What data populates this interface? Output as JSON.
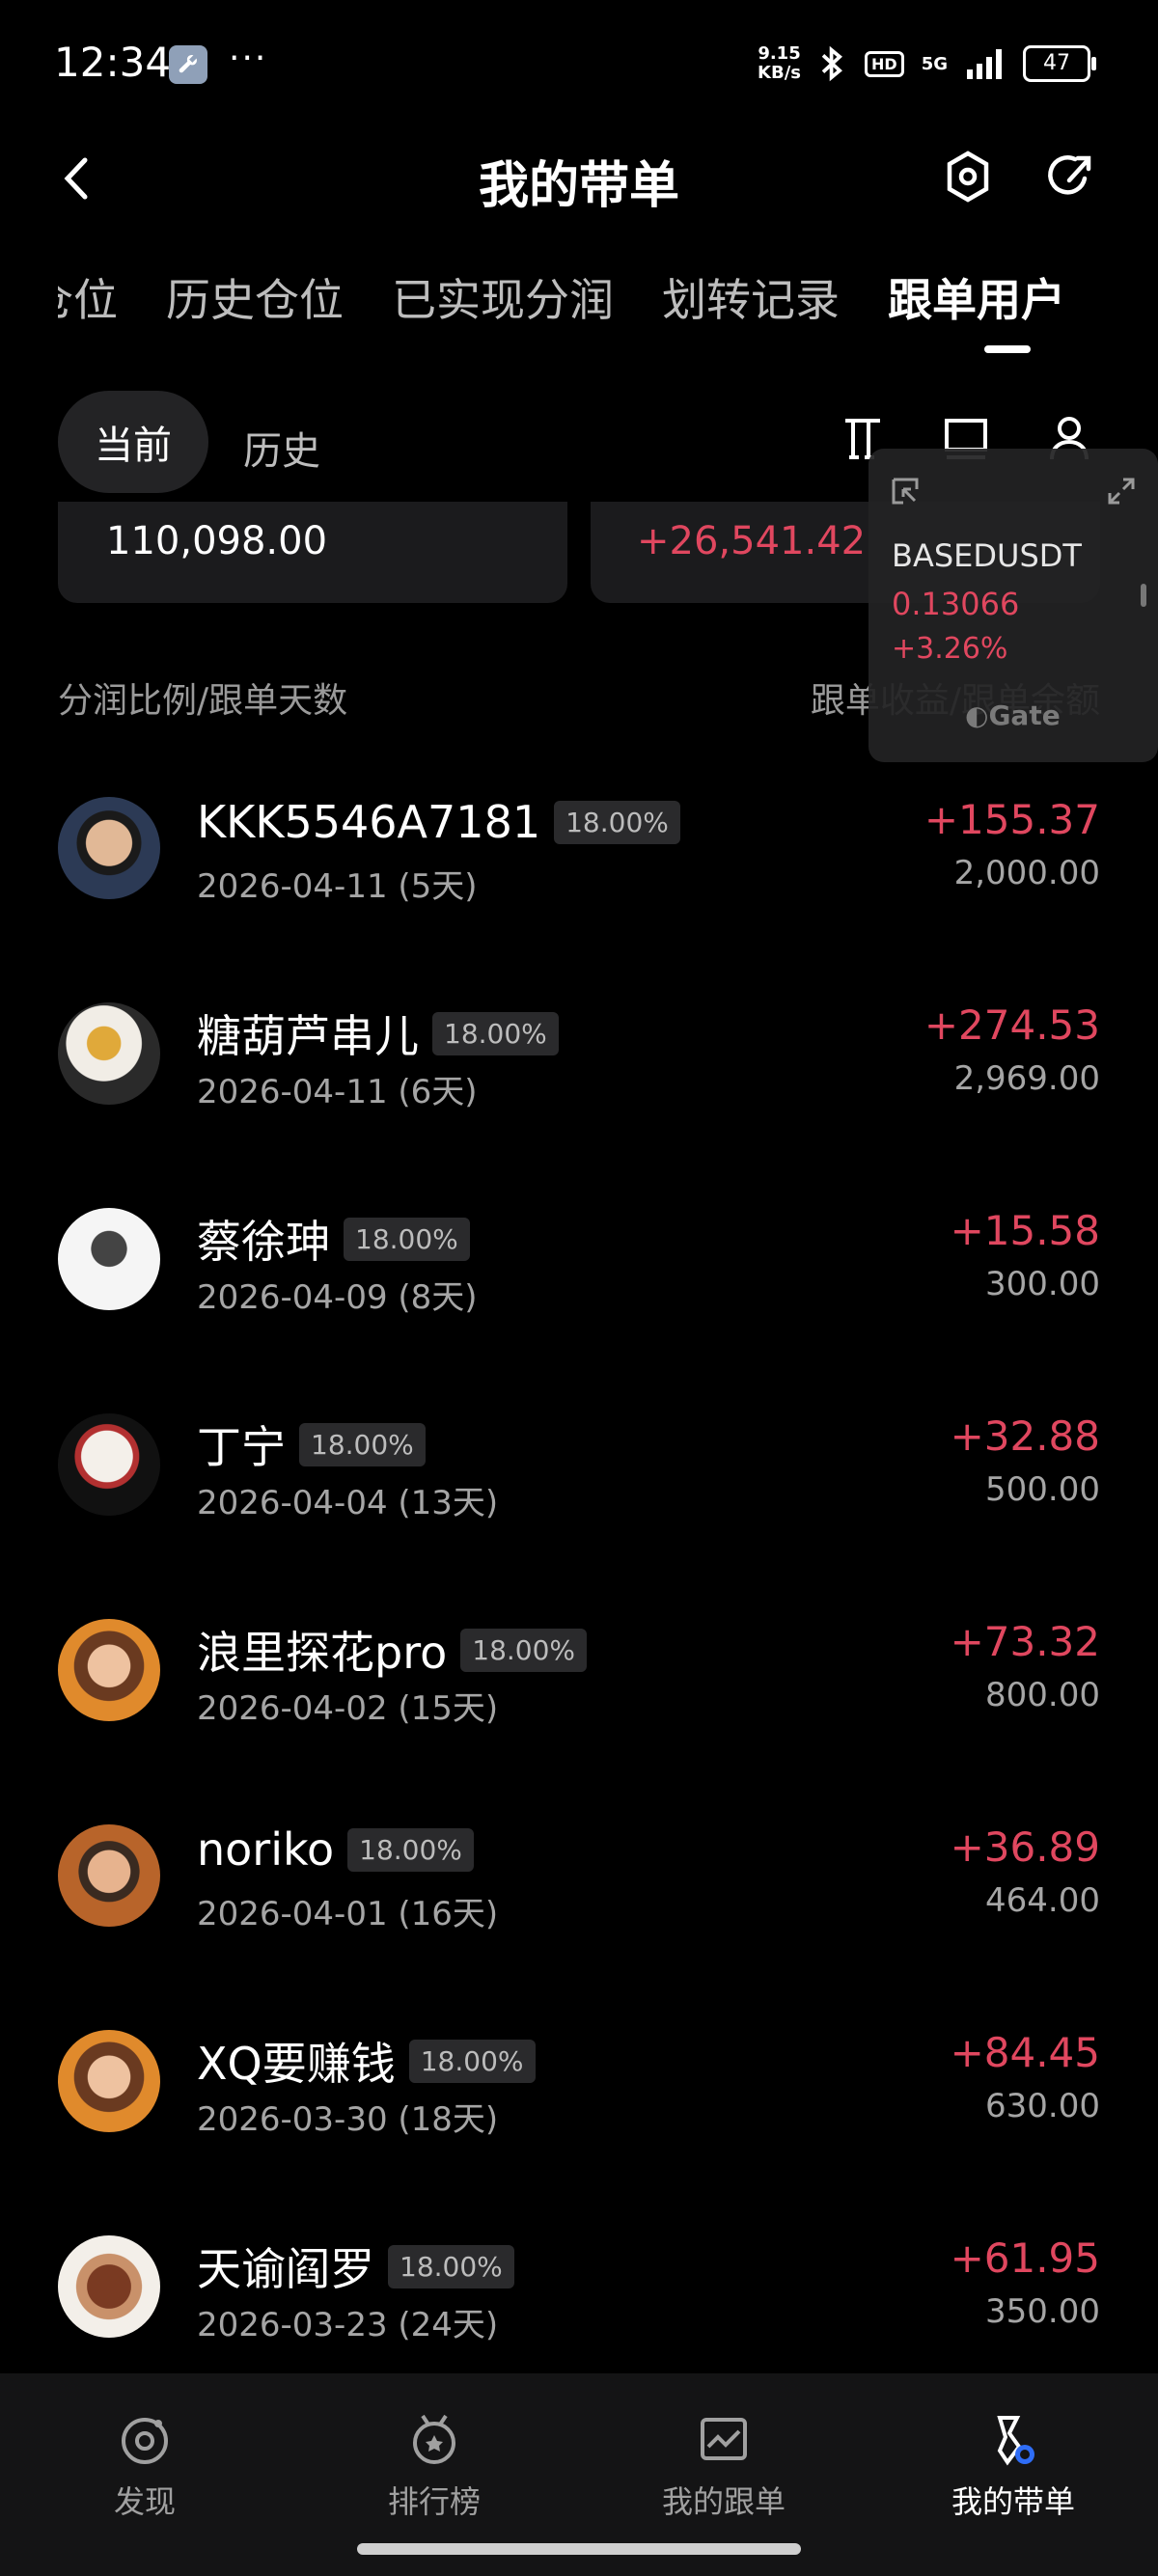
{
  "status_bar": {
    "time": "12:34",
    "speed_top": "9.15",
    "speed_bottom": "KB/s",
    "hd": "HD",
    "net": "5G",
    "battery": "47"
  },
  "header": {
    "title": "我的带单"
  },
  "tabs": [
    {
      "label": "仓位",
      "active": false
    },
    {
      "label": "历史仓位",
      "active": false
    },
    {
      "label": "已实现分润",
      "active": false
    },
    {
      "label": "划转记录",
      "active": false
    },
    {
      "label": "跟单用户",
      "active": true
    }
  ],
  "segment": {
    "current": "当前",
    "history": "历史"
  },
  "summary": {
    "left_value": "110,098.00",
    "right_value": "+26,541.42"
  },
  "widget": {
    "symbol": "BASEDUSDT",
    "price": "0.13066",
    "change": "+3.26%",
    "brand": "Gate"
  },
  "columns": {
    "left": "分润比例/跟单天数",
    "right": "跟单收益/跟单余额"
  },
  "users": [
    {
      "name": "KKK5546A7181",
      "ratio": "18.00%",
      "date": "2026-04-11 (5天)",
      "profit": "+155.37",
      "amount": "2,000.00"
    },
    {
      "name": "糖葫芦串儿",
      "ratio": "18.00%",
      "date": "2026-04-11 (6天)",
      "profit": "+274.53",
      "amount": "2,969.00"
    },
    {
      "name": "蔡徐珅",
      "ratio": "18.00%",
      "date": "2026-04-09 (8天)",
      "profit": "+15.58",
      "amount": "300.00"
    },
    {
      "name": "丁宁",
      "ratio": "18.00%",
      "date": "2026-04-04 (13天)",
      "profit": "+32.88",
      "amount": "500.00"
    },
    {
      "name": "浪里探花pro",
      "ratio": "18.00%",
      "date": "2026-04-02 (15天)",
      "profit": "+73.32",
      "amount": "800.00"
    },
    {
      "name": "noriko",
      "ratio": "18.00%",
      "date": "2026-04-01 (16天)",
      "profit": "+36.89",
      "amount": "464.00"
    },
    {
      "name": "XQ要赚钱",
      "ratio": "18.00%",
      "date": "2026-03-30 (18天)",
      "profit": "+84.45",
      "amount": "630.00"
    },
    {
      "name": "天谕阎罗",
      "ratio": "18.00%",
      "date": "2026-03-23 (24天)",
      "profit": "+61.95",
      "amount": "350.00"
    }
  ],
  "bottom_nav": [
    {
      "label": "发现",
      "icon": "discover-icon"
    },
    {
      "label": "排行榜",
      "icon": "ranking-icon"
    },
    {
      "label": "我的跟单",
      "icon": "my-copy-icon"
    },
    {
      "label": "我的带单",
      "icon": "my-lead-icon"
    }
  ],
  "colors": {
    "profit": "#e0475f",
    "background": "#000000"
  }
}
